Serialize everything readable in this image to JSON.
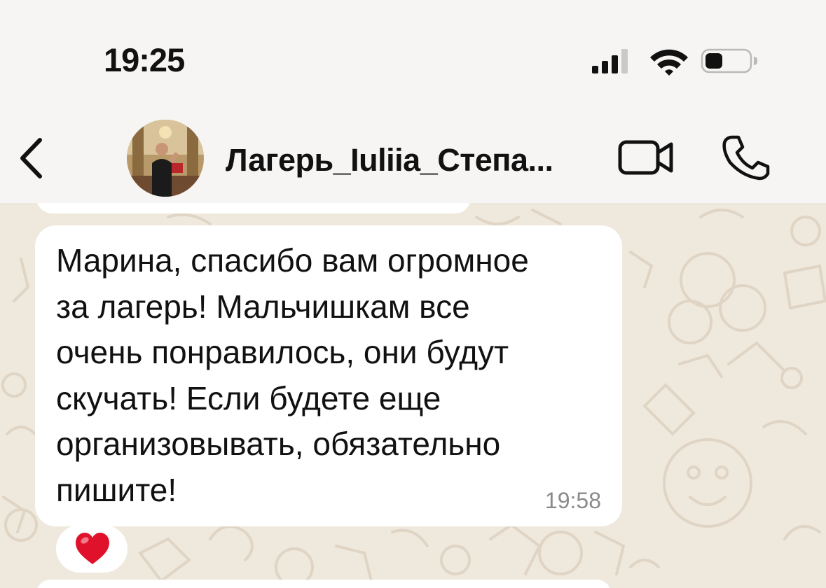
{
  "status_bar": {
    "time": "19:25",
    "icons": [
      "signal-icon",
      "wifi-icon",
      "battery-icon"
    ]
  },
  "header": {
    "back_icon": "chevron-left-icon",
    "contact_name": "Лагерь_Iuliia_Степа...",
    "video_icon": "video-camera-icon",
    "call_icon": "phone-icon"
  },
  "messages": [
    {
      "text": "Марина, спасибо вам огромное\nза лагерь! Мальчишкам все\nочень понравилось, они будут\nскучать! Если будете еще\nорганизовывать, обязательно\nпишите!",
      "time": "19:58",
      "reaction": "❤️"
    }
  ],
  "colors": {
    "background": "#f6f5f3",
    "chat_wallpaper": "#efe8dd",
    "bubble": "#ffffff",
    "timestamp": "#8a8a8a"
  }
}
